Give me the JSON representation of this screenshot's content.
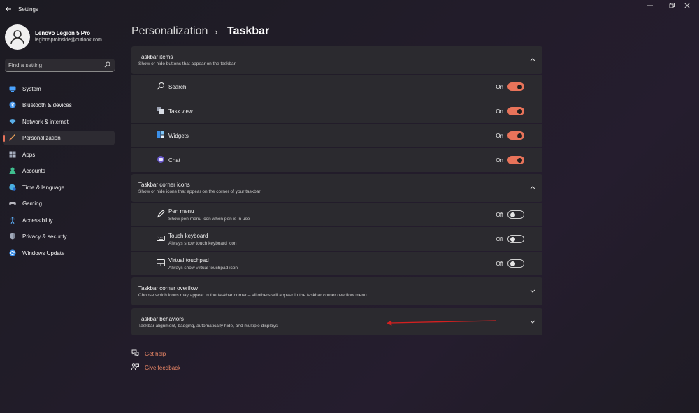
{
  "window": {
    "title": "Settings"
  },
  "profile": {
    "name": "Lenovo Legion 5 Pro",
    "email": "legion5proinside@outlook.com"
  },
  "search": {
    "placeholder": "Find a setting"
  },
  "nav": [
    {
      "label": "System",
      "icon": "monitor-icon",
      "color": "#4aa3ff"
    },
    {
      "label": "Bluetooth & devices",
      "icon": "bluetooth-icon",
      "color": "#3b8fe8"
    },
    {
      "label": "Network & internet",
      "icon": "wifi-icon",
      "color": "#5aaee8"
    },
    {
      "label": "Personalization",
      "icon": "brush-icon",
      "color": "#e8a25a",
      "active": true
    },
    {
      "label": "Apps",
      "icon": "apps-icon",
      "color": "#b0b8c8"
    },
    {
      "label": "Accounts",
      "icon": "person-icon",
      "color": "#3fbf8f"
    },
    {
      "label": "Time & language",
      "icon": "globe-clock-icon",
      "color": "#4ab0e0"
    },
    {
      "label": "Gaming",
      "icon": "gamepad-icon",
      "color": "#b8b8c0"
    },
    {
      "label": "Accessibility",
      "icon": "accessibility-icon",
      "color": "#5aa8f0"
    },
    {
      "label": "Privacy & security",
      "icon": "shield-icon",
      "color": "#a0a8b8"
    },
    {
      "label": "Windows Update",
      "icon": "refresh-icon",
      "color": "#3b8fe8"
    }
  ],
  "breadcrumb": {
    "parent": "Personalization",
    "separator": "›",
    "current": "Taskbar"
  },
  "sections": {
    "items": {
      "title": "Taskbar items",
      "desc": "Show or hide buttons that appear on the taskbar"
    },
    "corner_icons": {
      "title": "Taskbar corner icons",
      "desc": "Show or hide icons that appear on the corner of your taskbar"
    },
    "overflow": {
      "title": "Taskbar corner overflow",
      "desc": "Choose which icons may appear in the taskbar corner – all others will appear in the taskbar corner overflow menu"
    },
    "behaviors": {
      "title": "Taskbar behaviors",
      "desc": "Taskbar alignment, badging, automatically hide, and multiple displays"
    }
  },
  "taskbar_items": [
    {
      "label": "Search",
      "icon": "search-icon",
      "state": "On",
      "on": true
    },
    {
      "label": "Task view",
      "icon": "task-view-icon",
      "state": "On",
      "on": true
    },
    {
      "label": "Widgets",
      "icon": "widgets-icon",
      "state": "On",
      "on": true
    },
    {
      "label": "Chat",
      "icon": "chat-icon",
      "state": "On",
      "on": true
    }
  ],
  "corner_icons": [
    {
      "label": "Pen menu",
      "desc": "Show pen menu icon when pen is in use",
      "icon": "pen-icon",
      "state": "Off",
      "on": false
    },
    {
      "label": "Touch keyboard",
      "desc": "Always show touch keyboard icon",
      "icon": "keyboard-icon",
      "state": "Off",
      "on": false
    },
    {
      "label": "Virtual touchpad",
      "desc": "Always show virtual touchpad icon",
      "icon": "touchpad-icon",
      "state": "Off",
      "on": false
    }
  ],
  "footer": {
    "help": "Get help",
    "feedback": "Give feedback"
  },
  "colors": {
    "accent": "#e8735a",
    "link": "#f08a68",
    "annotation_arrow": "#d42020"
  }
}
